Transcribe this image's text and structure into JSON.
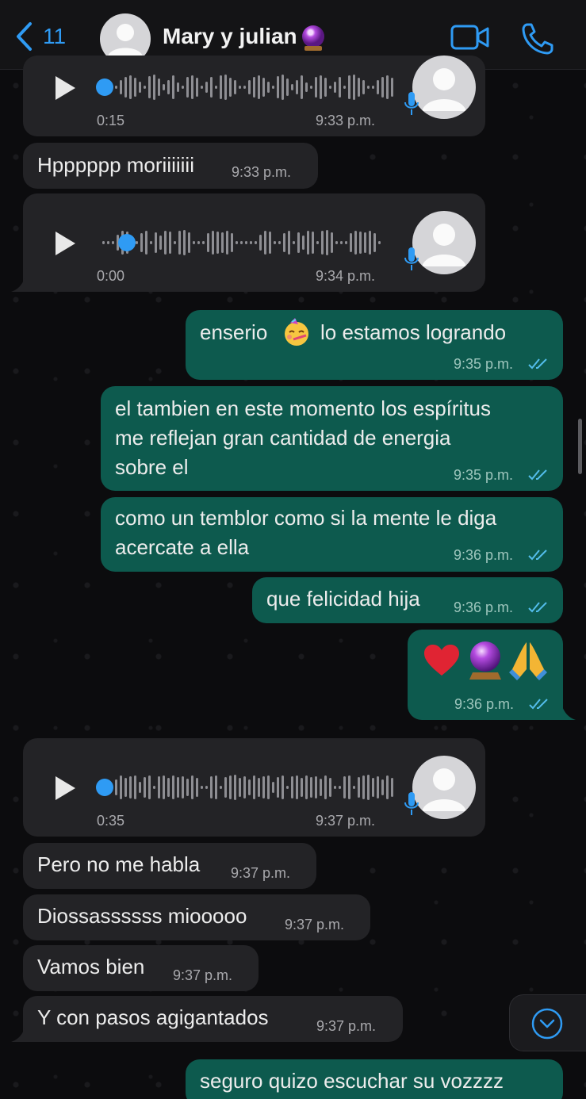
{
  "header": {
    "back_count": "11",
    "contact_name": "Mary y julian",
    "name_emoji": "crystal-ball-icon"
  },
  "messages": [
    {
      "type": "voice",
      "direction": "in",
      "duration": "0:15",
      "time": "9:33 p.m.",
      "progress": 0
    },
    {
      "type": "text",
      "direction": "in",
      "text": "Hpppppp moriiiiiii",
      "time": "9:33 p.m."
    },
    {
      "type": "voice",
      "direction": "in",
      "duration": "0:00",
      "time": "9:34 p.m.",
      "progress": 0.05
    },
    {
      "type": "text",
      "direction": "out",
      "text_before": "enserio",
      "emoji": "partying-face-icon",
      "text_after": "lo estamos logrando",
      "time": "9:35 p.m.",
      "status": "read"
    },
    {
      "type": "text",
      "direction": "out",
      "lines": [
        "el tambien en este momento los espíritus",
        "me reflejan gran cantidad de energia",
        "sobre el"
      ],
      "time": "9:35 p.m.",
      "status": "read"
    },
    {
      "type": "text",
      "direction": "out",
      "lines": [
        "como un temblor como si la mente le diga",
        "acercate a ella"
      ],
      "time": "9:36 p.m.",
      "status": "read"
    },
    {
      "type": "text",
      "direction": "out",
      "text": "que felicidad hija",
      "time": "9:36 p.m.",
      "status": "read"
    },
    {
      "type": "emoji",
      "direction": "out",
      "emojis": [
        "red-heart-icon",
        "crystal-ball-icon",
        "folded-hands-icon"
      ],
      "time": "9:36 p.m.",
      "status": "read"
    },
    {
      "type": "voice",
      "direction": "in",
      "duration": "0:35",
      "time": "9:37 p.m.",
      "progress": 0
    },
    {
      "type": "text",
      "direction": "in",
      "text": "Pero no me habla",
      "time": "9:37 p.m."
    },
    {
      "type": "text",
      "direction": "in",
      "text": "Diossassssss miooooo",
      "time": "9:37 p.m."
    },
    {
      "type": "text",
      "direction": "in",
      "text": "Vamos bien",
      "time": "9:37 p.m."
    },
    {
      "type": "text",
      "direction": "in",
      "text": "Y con pasos agigantados",
      "time": "9:37 p.m."
    },
    {
      "type": "text",
      "direction": "out",
      "text": "seguro quizo escuchar su vozzzz",
      "time": "",
      "status": ""
    }
  ],
  "colors": {
    "accent": "#2f9bf4",
    "incoming_bubble": "#232326",
    "outgoing_bubble": "#0d5a4e",
    "read_ticks": "#53bdeb"
  }
}
